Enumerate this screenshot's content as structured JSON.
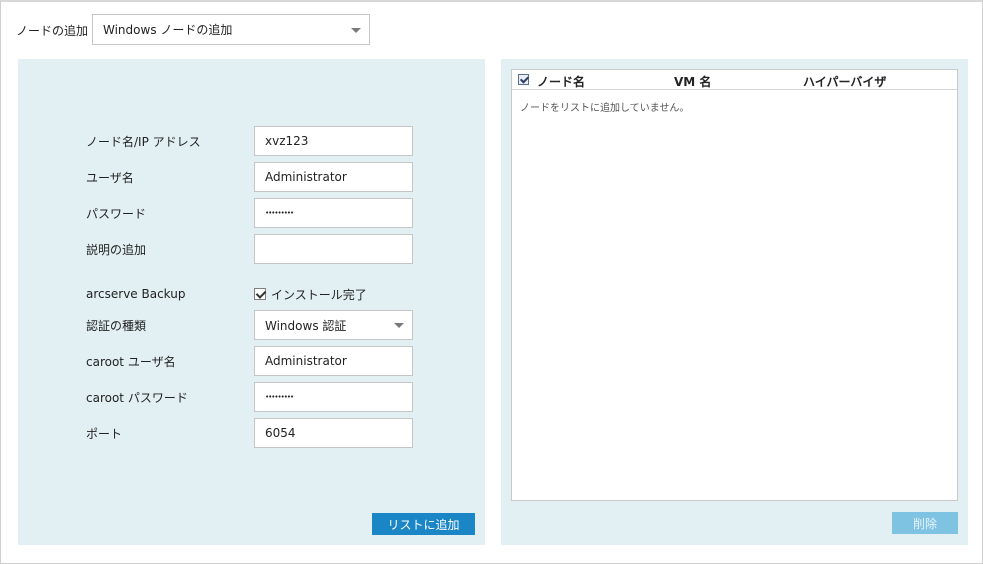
{
  "header": {
    "add_node_label": "ノードの追加",
    "add_node_select": "Windows ノードの追加"
  },
  "form": {
    "node_name_label": "ノード名/IP アドレス",
    "node_name_value": "xvz123",
    "user_label": "ユーザ名",
    "user_value": "Administrator",
    "password_label": "パスワード",
    "password_value": "•••••••••",
    "description_label": "説明の追加",
    "description_value": "",
    "backup_label": "arcserve Backup",
    "install_done_label": "インストール完了",
    "install_done_checked": true,
    "auth_type_label": "認証の種類",
    "auth_type_value": "Windows 認証",
    "caroot_user_label": "caroot ユーザ名",
    "caroot_user_value": "Administrator",
    "caroot_password_label": "caroot パスワード",
    "caroot_password_value": "•••••••••",
    "port_label": "ポート",
    "port_value": "6054",
    "add_button": "リストに追加"
  },
  "node_list": {
    "columns": [
      "ノード名",
      "VM 名",
      "ハイパーバイザ"
    ],
    "header_checked": true,
    "empty_message": "ノードをリストに追加していません。",
    "delete_button": "削除"
  },
  "colors": {
    "panel_bg": "#e2f0f4",
    "primary_button": "#1b86c6",
    "disabled_button": "#7ec3e2"
  }
}
